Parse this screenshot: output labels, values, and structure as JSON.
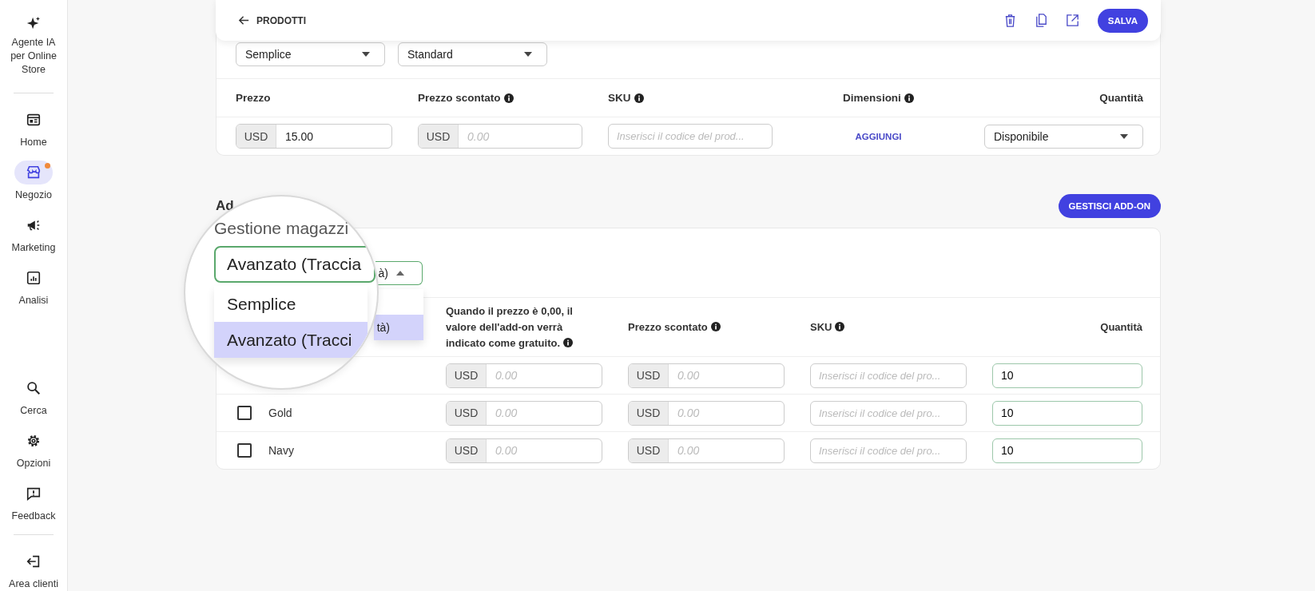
{
  "sidebar": {
    "header": {
      "kind": "ai",
      "label": "Agente IA per Online Store"
    },
    "nav": [
      {
        "kind": "home",
        "label": "Home",
        "selected": false,
        "notification": false
      },
      {
        "kind": "store",
        "label": "Negozio",
        "selected": true,
        "notification": true
      },
      {
        "kind": "megaphone",
        "label": "Marketing",
        "selected": false,
        "notification": false
      },
      {
        "kind": "chart",
        "label": "Analisi",
        "selected": false,
        "notification": false
      }
    ],
    "tools": [
      {
        "kind": "search",
        "label": "Cerca"
      },
      {
        "kind": "gear",
        "label": "Opzioni"
      },
      {
        "kind": "feedback",
        "label": "Feedback"
      }
    ],
    "footer": {
      "kind": "logout",
      "label": "Area clienti"
    }
  },
  "header": {
    "back_label": "PRODOTTI",
    "save_label": "SALVA"
  },
  "product": {
    "selects": [
      {
        "value": "Semplice"
      },
      {
        "value": "Standard"
      }
    ],
    "columns": [
      {
        "label": "Prezzo",
        "info": false
      },
      {
        "label": "Prezzo scontato",
        "info": true
      },
      {
        "label": "SKU",
        "info": true
      },
      {
        "label": "Dimensioni",
        "info": true
      },
      {
        "label": "Quantità",
        "info": false
      }
    ],
    "row": {
      "price": {
        "currency": "USD",
        "value": "15.00"
      },
      "discount": {
        "currency": "USD",
        "placeholder": "0.00"
      },
      "sku": {
        "placeholder": "Inserisci il codice del prod..."
      },
      "dimensions_link": "AGGIUNGI",
      "quantity": {
        "value": "Disponibile"
      }
    }
  },
  "addons": {
    "title": "Ad",
    "button": "GESTISCI ADD-ON",
    "stock_select": {
      "value": "à)",
      "open": true
    },
    "options": [
      {
        "selected": false
      },
      {
        "label": "tà)",
        "selected": true
      }
    ],
    "columns": [
      {
        "label": "Quando il prezzo è 0,00, il valore dell'add-on verrà indicato come gratuito.",
        "info": true
      },
      {
        "label": "Prezzo scontato",
        "info": true
      },
      {
        "label": "SKU",
        "info": true
      },
      {
        "label": "Quantità",
        "info": false
      }
    ],
    "rows": [
      {
        "price": {
          "currency": "USD",
          "placeholder": "0.00"
        },
        "discount": {
          "currency": "USD",
          "placeholder": "0.00"
        },
        "sku_placeholder": "Inserisci il codice del pro...",
        "quantity": "10"
      },
      {
        "checked": false,
        "name": "Gold",
        "price": {
          "currency": "USD",
          "placeholder": "0.00"
        },
        "discount": {
          "currency": "USD",
          "placeholder": "0.00"
        },
        "sku_placeholder": "Inserisci il codice del pro...",
        "quantity": "10"
      },
      {
        "checked": false,
        "name": "Navy",
        "price": {
          "currency": "USD",
          "placeholder": "0.00"
        },
        "discount": {
          "currency": "USD",
          "placeholder": "0.00"
        },
        "sku_placeholder": "Inserisci il codice del pro...",
        "quantity": "10"
      }
    ]
  },
  "magnifier": {
    "label": "Gestione magazzi",
    "select_value": "Avanzato (Traccia",
    "options": [
      {
        "label": "Semplice",
        "selected": false
      },
      {
        "label": "Avanzato (Tracci",
        "selected": true
      }
    ]
  }
}
